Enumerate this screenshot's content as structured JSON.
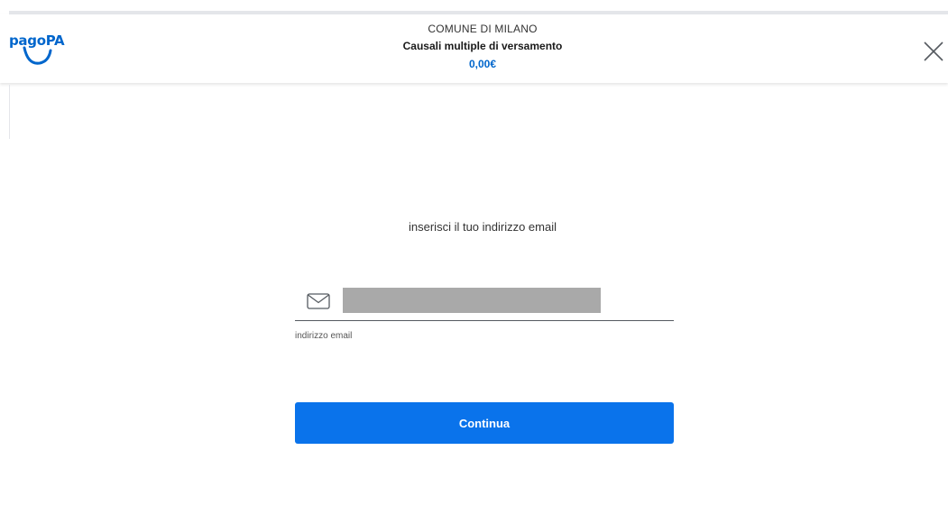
{
  "header": {
    "logo_text": "pagoPA",
    "organization": "COMUNE DI MILANO",
    "subject": "Causali multiple di versamento",
    "amount": "0,00€",
    "close_icon": "close-icon"
  },
  "form": {
    "instruction": "inserisci il tuo indirizzo email",
    "email_icon": "envelope-icon",
    "email_value": "",
    "email_label": "indirizzo email",
    "continue_label": "Continua"
  },
  "colors": {
    "brand_blue": "#0066cc",
    "button_blue": "#0a73eb",
    "redacted_grey": "#a9a9a9"
  }
}
